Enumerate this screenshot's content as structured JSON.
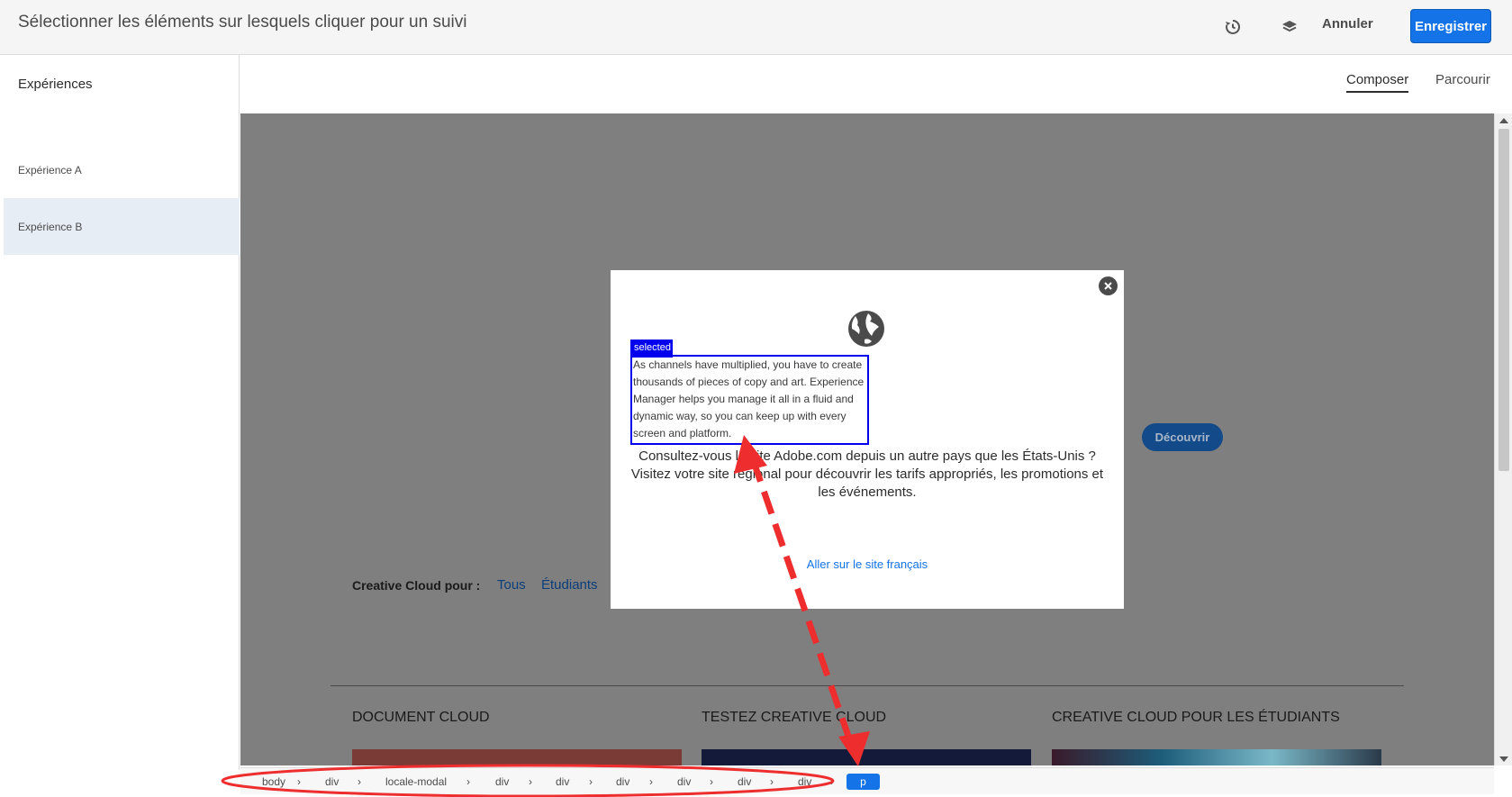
{
  "header": {
    "title": "Sélectionner les éléments sur lesquels cliquer pour un suivi",
    "history_icon": "history-icon",
    "layers_icon": "layers-icon",
    "cancel_label": "Annuler",
    "save_label": "Enregistrer"
  },
  "sidebar": {
    "heading": "Expériences",
    "items": [
      {
        "label": "Expérience A",
        "active": false
      },
      {
        "label": "Expérience B",
        "active": true
      }
    ]
  },
  "view_tabs": {
    "items": [
      {
        "label": "Composer",
        "active": true
      },
      {
        "label": "Parcourir",
        "active": false
      }
    ]
  },
  "page": {
    "discover_label": "Découvrir",
    "cc_label": "Creative Cloud pour :",
    "cc_links": [
      "Tous",
      "Étudiants"
    ],
    "sections": [
      "DOCUMENT CLOUD",
      "TESTEZ CREATIVE CLOUD",
      "CREATIVE CLOUD POUR LES ÉTUDIANTS"
    ]
  },
  "modal": {
    "globe_icon": "globe-icon",
    "close_icon": "close-icon",
    "selected_tag": "selected",
    "selected_text": "As channels have multiplied, you have to create thousands of pieces of copy and art. Experience Manager helps you manage it all in a fluid and dynamic way, so you can keep up with every screen and platform.",
    "message_line1": "Consultez-vous le site Adobe.com depuis un autre pays que les États-Unis ?",
    "message_line2": "Visitez votre site régional pour découvrir les tarifs appropriés, les promotions et les événements.",
    "link_label": "Aller sur le site français"
  },
  "breadcrumb": {
    "items": [
      "body",
      "div",
      "locale-modal",
      "div",
      "div",
      "div",
      "div",
      "div",
      "div",
      "p"
    ],
    "active_index": 9
  },
  "colors": {
    "accent": "#1473e6",
    "selection": "#0000ee",
    "annotation": "#ee2e2e"
  }
}
